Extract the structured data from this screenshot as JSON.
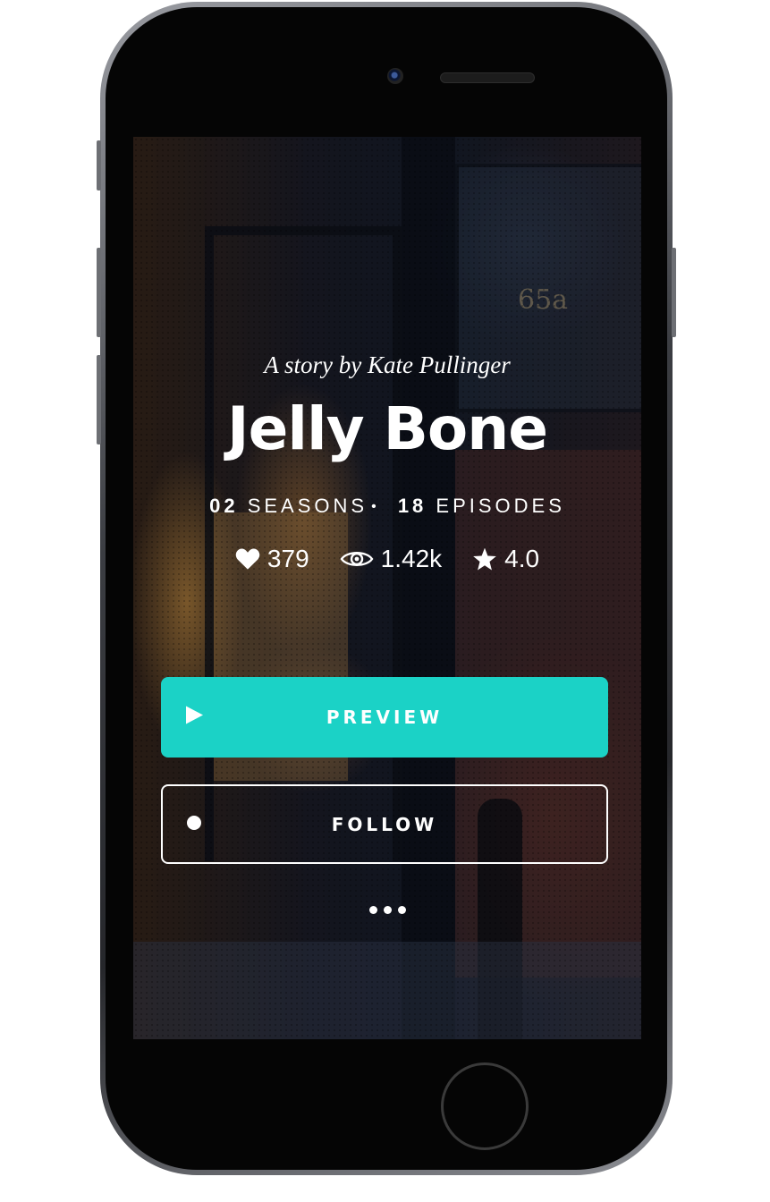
{
  "story": {
    "byline": "A story by Kate Pullinger",
    "title": "Jelly Bone",
    "seasons_count": "02",
    "seasons_label": "SEASONS",
    "episodes_count": "18",
    "episodes_label": "EPISODES",
    "separator": "•"
  },
  "stats": {
    "likes": "379",
    "views": "1.42k",
    "rating": "4.0"
  },
  "buttons": {
    "preview_label": "PREVIEW",
    "follow_label": "FOLLOW"
  },
  "background": {
    "door_number": "65a"
  },
  "colors": {
    "accent": "#1bd2c6",
    "text": "#ffffff"
  },
  "icons": [
    "heart-icon",
    "eye-icon",
    "star-icon",
    "play-icon",
    "follow-dot-icon",
    "more-dots-icon"
  ]
}
